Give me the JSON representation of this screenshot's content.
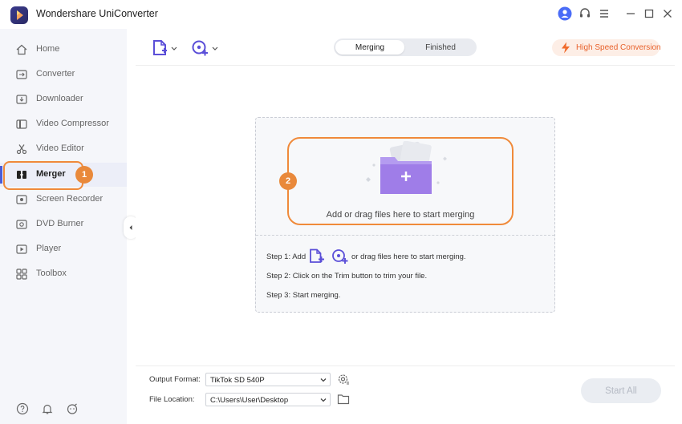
{
  "window": {
    "title": "Wondershare UniConverter",
    "controls": [
      "user-icon",
      "headset-icon",
      "menu-icon",
      "minimize-icon",
      "maximize-icon",
      "close-icon"
    ]
  },
  "sidebar": {
    "items": [
      {
        "id": "home",
        "label": "Home",
        "icon": "home-icon"
      },
      {
        "id": "converter",
        "label": "Converter",
        "icon": "converter-icon"
      },
      {
        "id": "downloader",
        "label": "Downloader",
        "icon": "download-icon"
      },
      {
        "id": "video-compressor",
        "label": "Video Compressor",
        "icon": "compress-icon"
      },
      {
        "id": "video-editor",
        "label": "Video Editor",
        "icon": "scissors-icon"
      },
      {
        "id": "merger",
        "label": "Merger",
        "icon": "merge-icon",
        "active": true
      },
      {
        "id": "screen-recorder",
        "label": "Screen Recorder",
        "icon": "record-icon"
      },
      {
        "id": "dvd-burner",
        "label": "DVD Burner",
        "icon": "disc-icon"
      },
      {
        "id": "player",
        "label": "Player",
        "icon": "play-icon"
      },
      {
        "id": "toolbox",
        "label": "Toolbox",
        "icon": "grid-icon"
      }
    ],
    "bottom_icons": [
      "help-icon",
      "bell-icon",
      "feedback-icon"
    ]
  },
  "callouts": {
    "one": "1",
    "two": "2"
  },
  "toolbar": {
    "tabs": [
      {
        "label": "Merging",
        "active": true
      },
      {
        "label": "Finished",
        "active": false
      }
    ],
    "high_speed_label": "High Speed Conversion"
  },
  "dropzone": {
    "label": "Add or drag files here to start merging",
    "step1_prefix": "Step 1: Add",
    "step1_suffix": "or drag files here to start merging.",
    "step2": "Step 2: Click on the Trim button to trim your file.",
    "step3": "Step 3: Start merging."
  },
  "footer": {
    "output_format_label": "Output Format:",
    "output_format_value": "TikTok SD 540P",
    "file_location_label": "File Location:",
    "file_location_value": "C:\\Users\\User\\Desktop",
    "start_all_label": "Start All"
  },
  "colors": {
    "accent": "#4a5bd6",
    "callout": "#f08a3a",
    "folder": "#9f7de8",
    "high_speed": "#e8622c"
  }
}
